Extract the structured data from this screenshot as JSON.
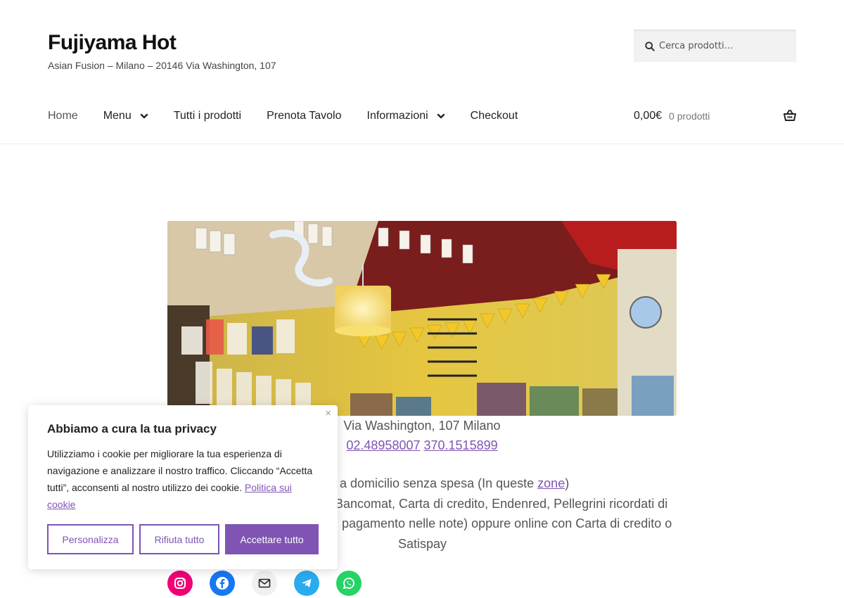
{
  "header": {
    "site_title": "Fujiyama Hot",
    "tagline": "Asian Fusion – Milano – 20146 Via Washington, 107",
    "search_placeholder": "Cerca prodotti…"
  },
  "nav": {
    "items": [
      {
        "label": "Home"
      },
      {
        "label": "Menu",
        "dropdown": true
      },
      {
        "label": "Tutti i prodotti"
      },
      {
        "label": "Prenota Tavolo"
      },
      {
        "label": "Informazioni",
        "dropdown": true
      },
      {
        "label": "Checkout"
      }
    ]
  },
  "cart": {
    "amount": "0,00€",
    "count": "0 prodotti"
  },
  "content": {
    "address": "Via Washington, 107 Milano",
    "phone1": "02.48958007",
    "phone2": "370.1515899",
    "delivery_text": "a domicilio senza spesa (In queste",
    "delivery_link": "zone",
    "delivery_close": ")",
    "payment_line1": "Bancomat, Carta di credito, Endenred, Pellegrini ricordati di",
    "payment_line2": "pagamento nelle note) oppure online con Carta di credito o",
    "payment_line3": "Satispay"
  },
  "social": [
    {
      "icon": "instagram-icon",
      "color": "#f00075"
    },
    {
      "icon": "facebook-icon",
      "color": "#1877f2"
    },
    {
      "icon": "mail-icon",
      "color": "#f0f0f0"
    },
    {
      "icon": "telegram-icon",
      "color": "#2aabee"
    },
    {
      "icon": "whatsapp-icon",
      "color": "#25d366"
    }
  ],
  "cookie": {
    "title": "Abbiamo a cura la tua privacy",
    "text": "Utilizziamo i cookie per migliorare la tua esperienza di navigazione e analizzare il nostro traffico. Cliccando “Accetta tutti”, acconsenti al nostro utilizzo dei cookie.",
    "policy_link": "Politica sui cookie",
    "close": "×",
    "customize": "Personalizza",
    "reject": "Rifiuta tutto",
    "accept": "Accettare tutto"
  },
  "colors": {
    "accent": "#7f54b3"
  }
}
